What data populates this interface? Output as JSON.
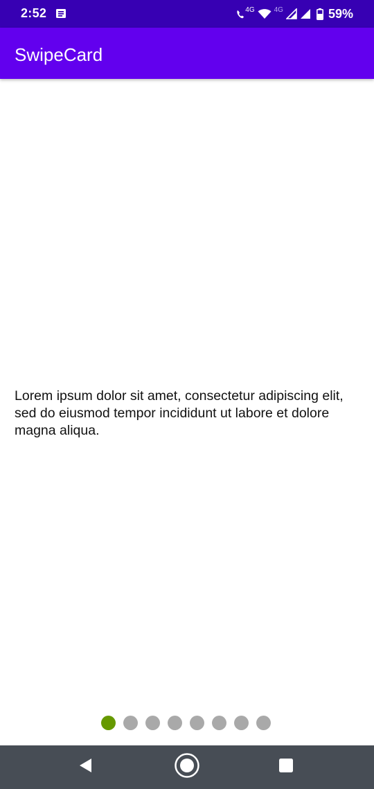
{
  "status_bar": {
    "time": "2:52",
    "call_network_label": "4G",
    "secondary_network_label": "4G",
    "battery": "59%",
    "icons": [
      "notification-message-icon",
      "volte-call-icon",
      "wifi-icon",
      "signal-icon",
      "signal-icon",
      "battery-icon"
    ]
  },
  "app_bar": {
    "title": "SwipeCard",
    "color": "#6200ee"
  },
  "card": {
    "text": "Lorem ipsum dolor sit amet, consectetur adipiscing elit, sed do eiusmod tempor incididunt ut labore et dolore magna aliqua."
  },
  "page_indicator": {
    "total": 8,
    "active_index": 0,
    "active_color": "#669900",
    "inactive_color": "#a9a9a9"
  },
  "nav_bar": {
    "buttons": [
      "back-icon",
      "home-icon",
      "recents-icon"
    ]
  }
}
